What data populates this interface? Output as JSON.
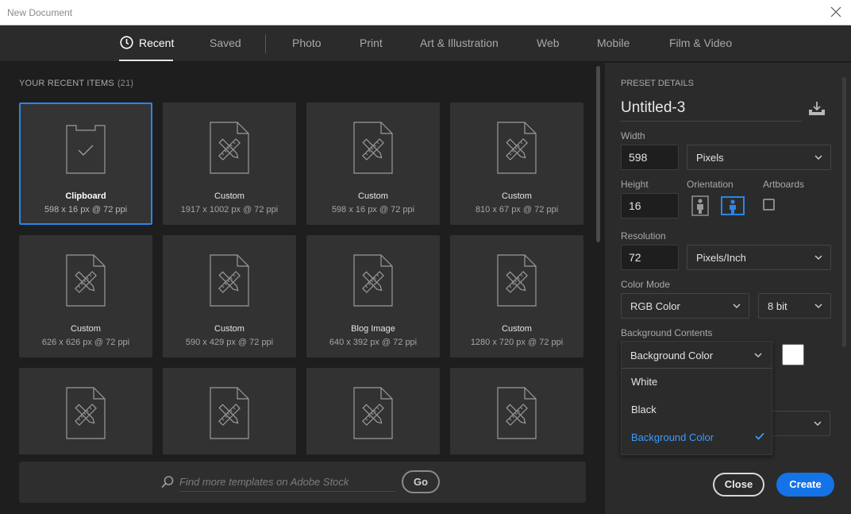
{
  "window": {
    "title": "New Document"
  },
  "tabs": [
    {
      "label": "Recent",
      "icon": "clock-icon",
      "active": true
    },
    {
      "label": "Saved"
    },
    {
      "label": "Photo"
    },
    {
      "label": "Print"
    },
    {
      "label": "Art & Illustration"
    },
    {
      "label": "Web"
    },
    {
      "label": "Mobile"
    },
    {
      "label": "Film & Video"
    }
  ],
  "recent": {
    "label": "YOUR RECENT ITEMS",
    "count": "(21)",
    "items": [
      {
        "name": "Clipboard",
        "dims": "598 x 16 px @ 72 ppi",
        "icon": "clipboard-icon",
        "selected": true
      },
      {
        "name": "Custom",
        "dims": "1917 x 1002 px @ 72 ppi",
        "icon": "custom-document-icon"
      },
      {
        "name": "Custom",
        "dims": "598 x 16 px @ 72 ppi",
        "icon": "custom-document-icon"
      },
      {
        "name": "Custom",
        "dims": "810 x 67 px @ 72 ppi",
        "icon": "custom-document-icon"
      },
      {
        "name": "Custom",
        "dims": "626 x 626 px @ 72 ppi",
        "icon": "custom-document-icon"
      },
      {
        "name": "Custom",
        "dims": "590 x 429 px @ 72 ppi",
        "icon": "custom-document-icon"
      },
      {
        "name": "Blog Image",
        "dims": "640 x 392 px @ 72 ppi",
        "icon": "custom-document-icon"
      },
      {
        "name": "Custom",
        "dims": "1280 x 720 px @ 72 ppi",
        "icon": "custom-document-icon"
      },
      {
        "name": "",
        "dims": "",
        "icon": "custom-document-icon"
      },
      {
        "name": "",
        "dims": "",
        "icon": "custom-document-icon"
      },
      {
        "name": "",
        "dims": "",
        "icon": "custom-document-icon"
      },
      {
        "name": "",
        "dims": "",
        "icon": "custom-document-icon"
      }
    ]
  },
  "search": {
    "placeholder": "Find more templates on Adobe Stock",
    "value": "",
    "go_label": "Go"
  },
  "preset": {
    "label": "PRESET DETAILS",
    "doc_name": "Untitled-3",
    "width_label": "Width",
    "width_value": "598",
    "width_unit": "Pixels",
    "height_label": "Height",
    "height_value": "16",
    "orientation_label": "Orientation",
    "artboards_label": "Artboards",
    "artboards_checked": false,
    "resolution_label": "Resolution",
    "resolution_value": "72",
    "resolution_unit": "Pixels/Inch",
    "color_mode_label": "Color Mode",
    "color_mode": "RGB Color",
    "bit_depth": "8 bit",
    "background_label": "Background Contents",
    "background_value": "Background Color",
    "background_swatch": "#ffffff",
    "background_options": [
      {
        "label": "White",
        "selected": false
      },
      {
        "label": "Black",
        "selected": false
      },
      {
        "label": "Background Color",
        "selected": true
      }
    ]
  },
  "buttons": {
    "close": "Close",
    "create": "Create"
  },
  "colors": {
    "accent": "#1473e6",
    "selection": "#2a86e8",
    "selected_option": "#3a9bff"
  }
}
